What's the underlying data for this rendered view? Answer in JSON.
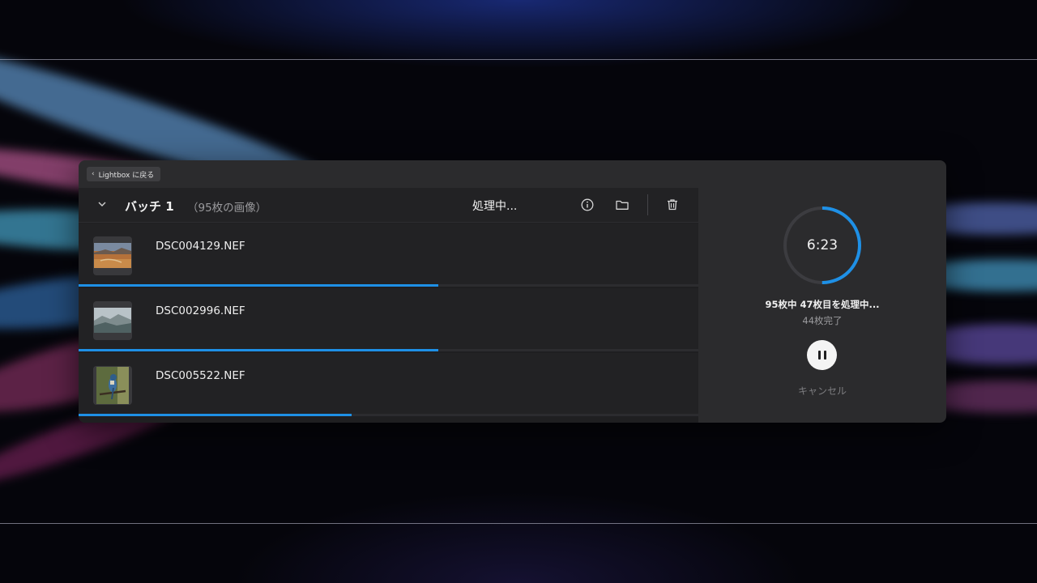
{
  "nav": {
    "back_label": "Lightbox に戻る"
  },
  "batch": {
    "title": "バッチ 1",
    "count": "（95枚の画像）",
    "status": "処理中..."
  },
  "files": [
    {
      "name": "DSC004129.NEF",
      "progress": 0.58,
      "thumb": "desert-landscape"
    },
    {
      "name": "DSC002996.NEF",
      "progress": 0.58,
      "thumb": "misty-mountains"
    },
    {
      "name": "DSC005522.NEF",
      "progress": 0.44,
      "thumb": "bird-on-branch"
    }
  ],
  "timer": {
    "value": "6:23",
    "progress": 0.5
  },
  "processing": {
    "main": "95枚中 47枚目を処理中...",
    "sub": "44枚完了"
  },
  "actions": {
    "cancel_label": "キャンセル"
  },
  "colors": {
    "accent": "#1e90e6",
    "panel": "#2b2b2d",
    "list_bg": "#1f1f21"
  },
  "icons": [
    "chevron-left-icon",
    "chevron-down-icon",
    "info-icon",
    "folder-icon",
    "trash-icon",
    "pause-icon"
  ]
}
